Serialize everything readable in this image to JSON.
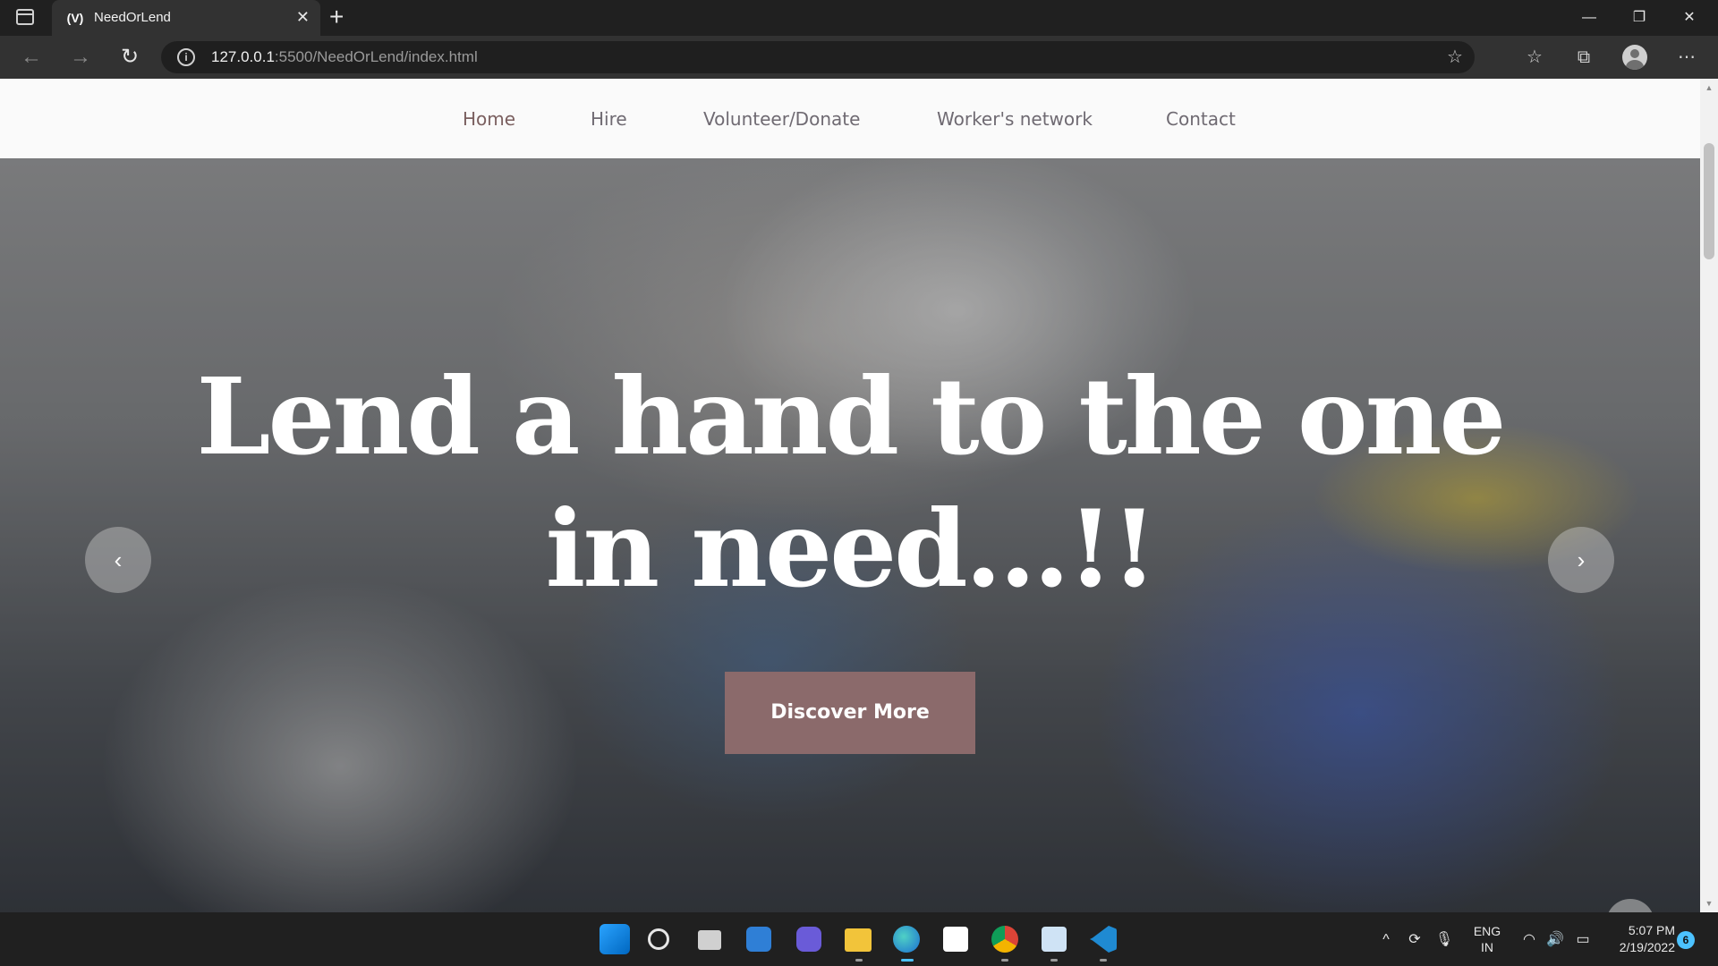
{
  "browser": {
    "tab_title": "NeedOrLend",
    "favicon_text": "(V)",
    "tab_close": "✕",
    "new_tab": "+",
    "url_host": "127.0.0.1",
    "url_rest": ":5500/NeedOrLend/index.html",
    "window_controls": {
      "minimize": "—",
      "restore": "❐",
      "close": "✕"
    },
    "icons": {
      "back": "←",
      "forward": "→",
      "refresh": "↻",
      "info": "i",
      "add_favorite": "☆",
      "favorites": "☆",
      "collections": "⧉",
      "more": "⋯"
    }
  },
  "site": {
    "nav": [
      "Home",
      "Hire",
      "Volunteer/Donate",
      "Worker's network",
      "Contact"
    ],
    "hero": {
      "heading_line1": "Lend a hand to the one",
      "heading_line2": "in need...!!",
      "cta_label": "Discover More",
      "prev_arrow": "‹",
      "next_arrow": "›",
      "back_to_top": "⌃"
    }
  },
  "scrollbar": {
    "up": "▲",
    "down": "▼"
  },
  "taskbar": {
    "language_line1": "ENG",
    "language_line2": "IN",
    "time": "5:07 PM",
    "date": "2/19/2022",
    "notification_count": "6",
    "tray_icons": {
      "chevron": "^",
      "mic": "🎙",
      "wifi": "◠",
      "volume": "🔊",
      "battery": "▭"
    }
  }
}
